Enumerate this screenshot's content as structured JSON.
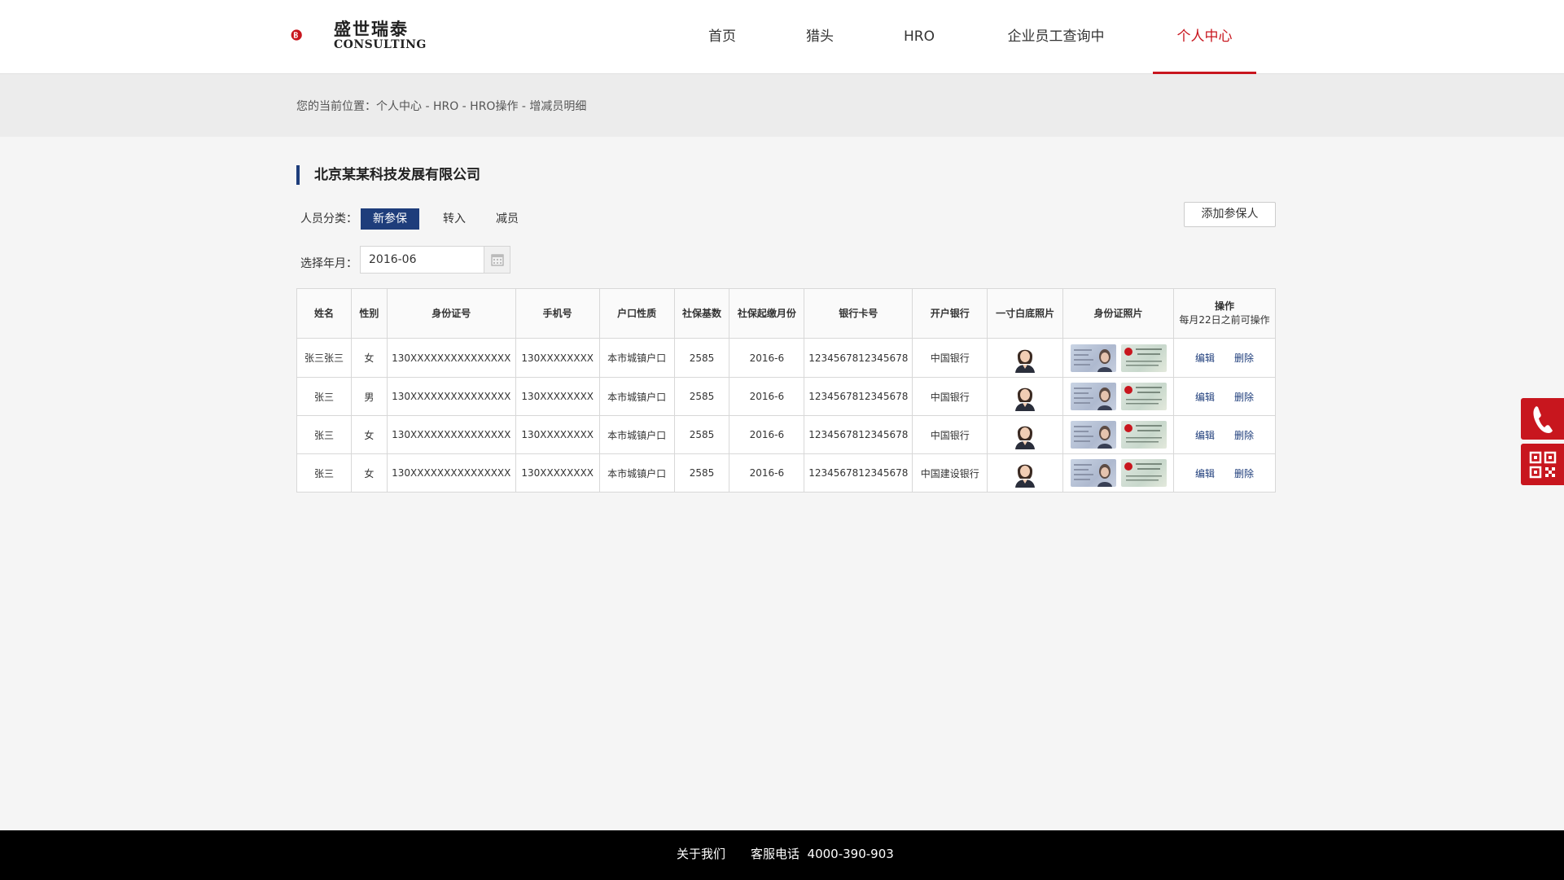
{
  "brand": {
    "name_cn": "盛世瑞泰",
    "name_en": "CONSULTING",
    "accent": "#c8161e",
    "primary": "#1e3d7b"
  },
  "nav": {
    "items": [
      {
        "label": "首页"
      },
      {
        "label": "猎头"
      },
      {
        "label": "HRO"
      },
      {
        "label": "企业员工查询中心"
      },
      {
        "label": "个人中心",
        "active": true
      }
    ]
  },
  "breadcrumb": "您的当前位置：个人中心 - HRO - HRO操作 - 增减员明细",
  "company": "北京某某科技发展有限公司",
  "category": {
    "label": "人员分类：",
    "options": [
      "新参保",
      "转入",
      "减员"
    ],
    "selected": "新参保"
  },
  "add_button": "添加参保人",
  "year_month": {
    "label": "选择年月：",
    "value": "2016-06"
  },
  "table": {
    "headers": [
      "姓名",
      "性别",
      "身份证号",
      "手机号",
      "户口性质",
      "社保基数",
      "社保起缴月份",
      "银行卡号",
      "开户银行",
      "一寸白底照片",
      "身份证照片"
    ],
    "op_header": "操作",
    "op_note": "每月22日之前可操作",
    "edit_label": "编辑",
    "delete_label": "删除",
    "rows": [
      {
        "name": "张三张三",
        "gender": "女",
        "id_no": "130XXXXXXXXXXXXXXX",
        "phone": "130XXXXXXXX",
        "hukou": "本市城镇户口",
        "base": "2585",
        "start": "2016-6",
        "card": "1234567812345678",
        "bank": "中国银行"
      },
      {
        "name": "张三",
        "gender": "男",
        "id_no": "130XXXXXXXXXXXXXXX",
        "phone": "130XXXXXXXX",
        "hukou": "本市城镇户口",
        "base": "2585",
        "start": "2016-6",
        "card": "1234567812345678",
        "bank": "中国银行"
      },
      {
        "name": "张三",
        "gender": "女",
        "id_no": "130XXXXXXXXXXXXXXX",
        "phone": "130XXXXXXXX",
        "hukou": "本市城镇户口",
        "base": "2585",
        "start": "2016-6",
        "card": "1234567812345678",
        "bank": "中国银行"
      },
      {
        "name": "张三",
        "gender": "女",
        "id_no": "130XXXXXXXXXXXXXXX",
        "phone": "130XXXXXXXX",
        "hukou": "本市城镇户口",
        "base": "2585",
        "start": "2016-6",
        "card": "1234567812345678",
        "bank": "中国建设银行"
      }
    ]
  },
  "side": {
    "phone_icon": "phone-icon",
    "qr_icon": "qrcode-icon"
  },
  "footer": {
    "about": "关于我们",
    "service": "客服电话  4000-390-903"
  }
}
